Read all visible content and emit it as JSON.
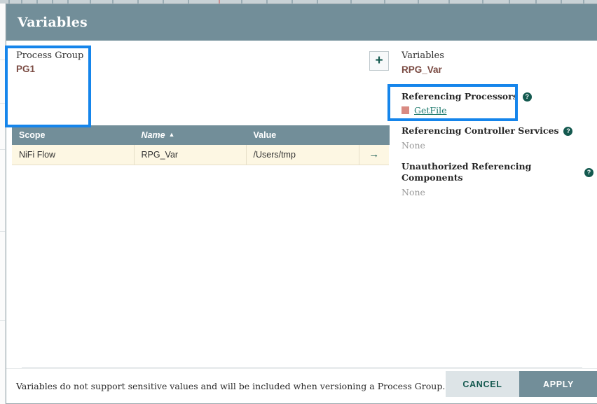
{
  "dialog": {
    "title": "Variables"
  },
  "process_group": {
    "label": "Process Group",
    "name": "PG1"
  },
  "table": {
    "columns": [
      "Scope",
      "",
      "Name",
      "Value",
      ""
    ],
    "sort_column": "Name",
    "sort_direction": "asc",
    "sort_caret": "▲",
    "rows": [
      {
        "scope": "NiFi Flow",
        "blank": "",
        "name": "RPG_Var",
        "value": "/Users/tmp",
        "go_arrow": "→"
      }
    ]
  },
  "details": {
    "add_button_label": "+",
    "selected_label": "Variables",
    "selected_value": "RPG_Var",
    "help_glyph": "?",
    "sections": [
      {
        "title": "Referencing Processors",
        "items": [
          {
            "name": "GetFile",
            "status_color": "#d98b83"
          }
        ],
        "empty_text": ""
      },
      {
        "title": "Referencing Controller Services",
        "items": [],
        "empty_text": "None"
      },
      {
        "title": "Unauthorized Referencing Components",
        "items": [],
        "empty_text": "None"
      }
    ]
  },
  "footer": {
    "note": "Variables do not support sensitive values and will be included when versioning a Process Group.",
    "cancel_label": "CANCEL",
    "apply_label": "APPLY"
  },
  "annotations": [
    {
      "name": "process-group-scope-highlight",
      "color": "#1585eb"
    },
    {
      "name": "referencing-processors-highlight",
      "color": "#1585eb"
    }
  ],
  "colors": {
    "header_bg": "#728e99",
    "row_bg": "#fdf7e3",
    "accent_text": "#7a4a42",
    "link": "#1f7a6e",
    "highlight": "#1585eb"
  }
}
